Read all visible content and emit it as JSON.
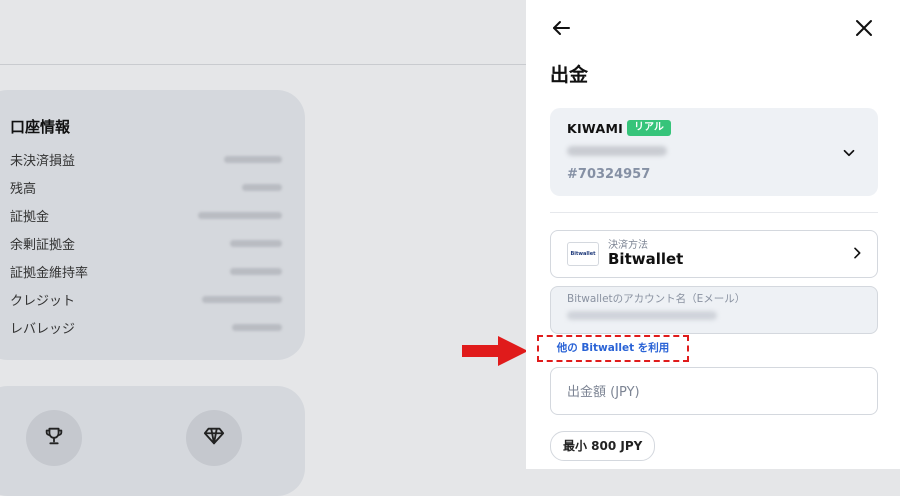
{
  "background": {
    "account_info": {
      "title": "口座情報",
      "rows": [
        {
          "label": "未決済損益"
        },
        {
          "label": "残高"
        },
        {
          "label": "証拠金"
        },
        {
          "label": "余剰証拠金"
        },
        {
          "label": "証拠金維持率"
        },
        {
          "label": "クレジット"
        },
        {
          "label": "レバレッジ"
        }
      ]
    },
    "icons": [
      "trophy-icon",
      "diamond-icon"
    ]
  },
  "panel": {
    "title": "出金",
    "back_icon": "arrow-left-icon",
    "close_icon": "close-icon",
    "account": {
      "name": "KIWAMI",
      "badge": "リアル",
      "id": "#70324957",
      "badge_color": "#36c47a"
    },
    "payment_method": {
      "label": "決済方法",
      "value": "Bitwallet",
      "logo_text": "Bitwallet"
    },
    "bitwallet_account": {
      "label": "Bitwalletのアカウント名（Eメール）"
    },
    "other_link": "他の Bitwallet を利用",
    "amount": {
      "placeholder": "出金額 (JPY)"
    },
    "min_chip": "最小 800 JPY"
  },
  "colors": {
    "annotation_red": "#e01b1b",
    "link_blue": "#2a63d6"
  }
}
